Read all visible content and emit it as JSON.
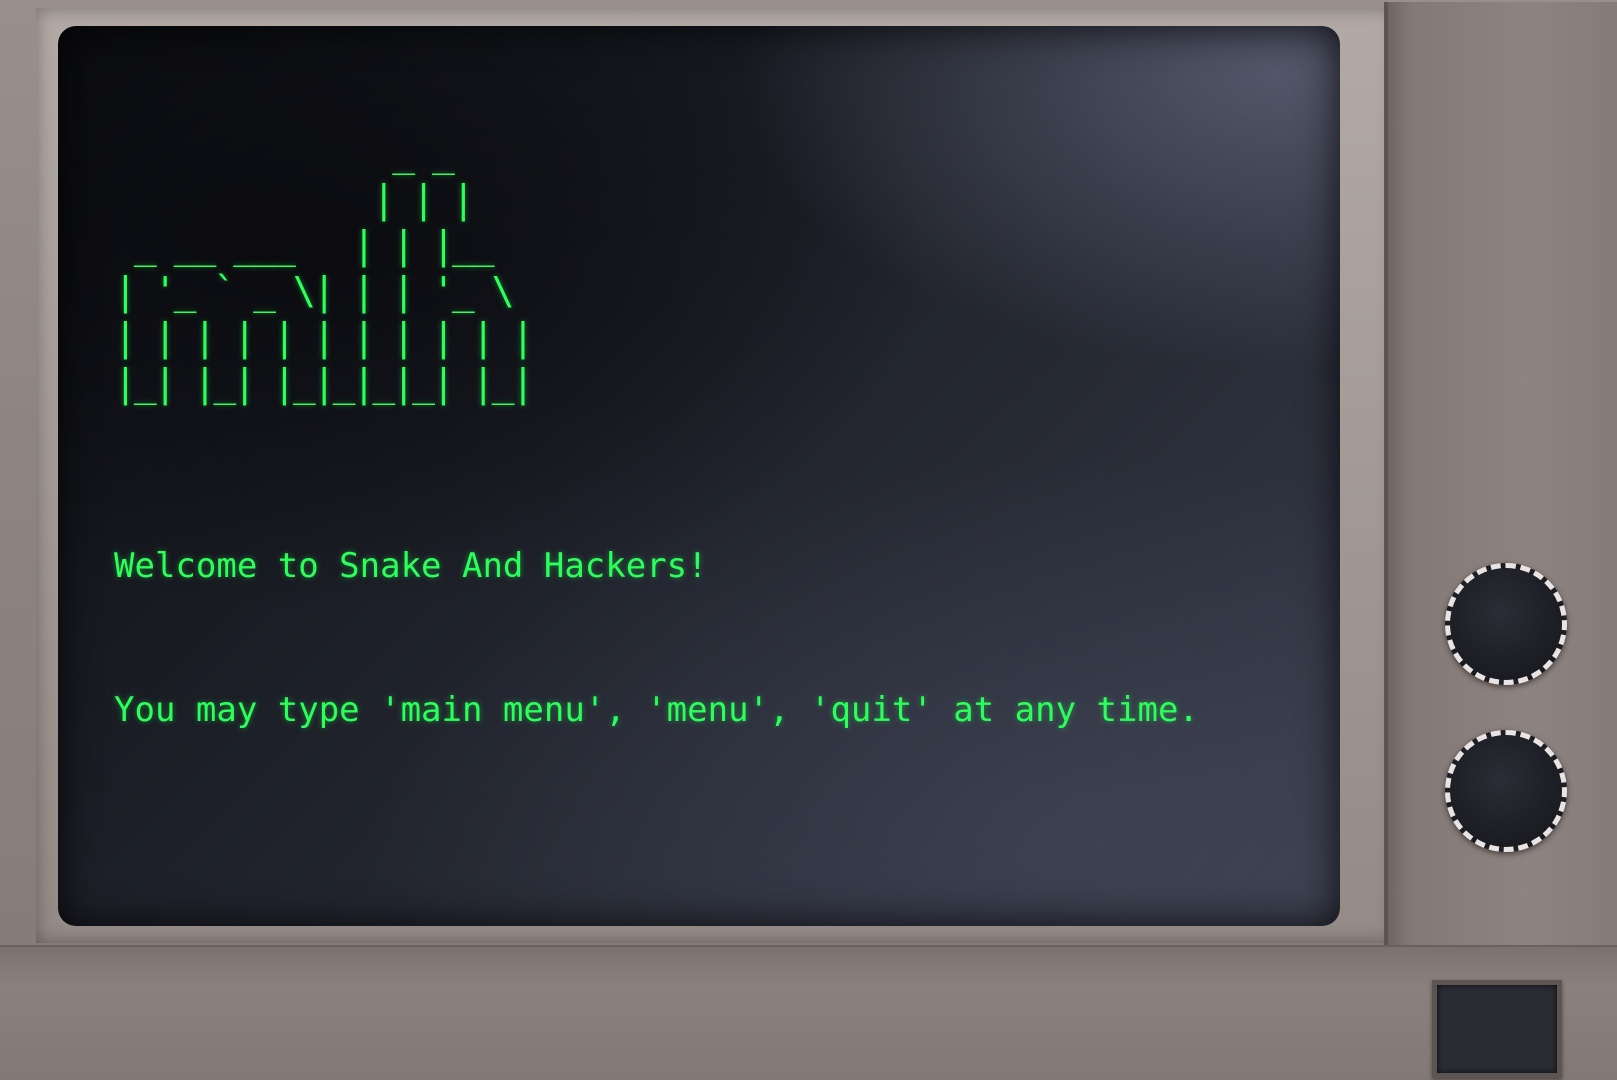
{
  "screen": {
    "ascii_logo": "              _ _     \n             | | |    \n _ __ ___   | | |__  \n| '_ ` _ \\| | | '_ \\ \n| | | | | | | | | | |\n|_| |_| |_|_|_|_| |_|",
    "messages": [
      "Welcome to Snake And Hackers!",
      "You may type 'main menu', 'menu', 'quit' at any time."
    ],
    "text_color": "#2bff5a"
  },
  "controls": {
    "knobs": [
      "knob-1",
      "knob-2"
    ],
    "power_button_icon": "power-button"
  }
}
